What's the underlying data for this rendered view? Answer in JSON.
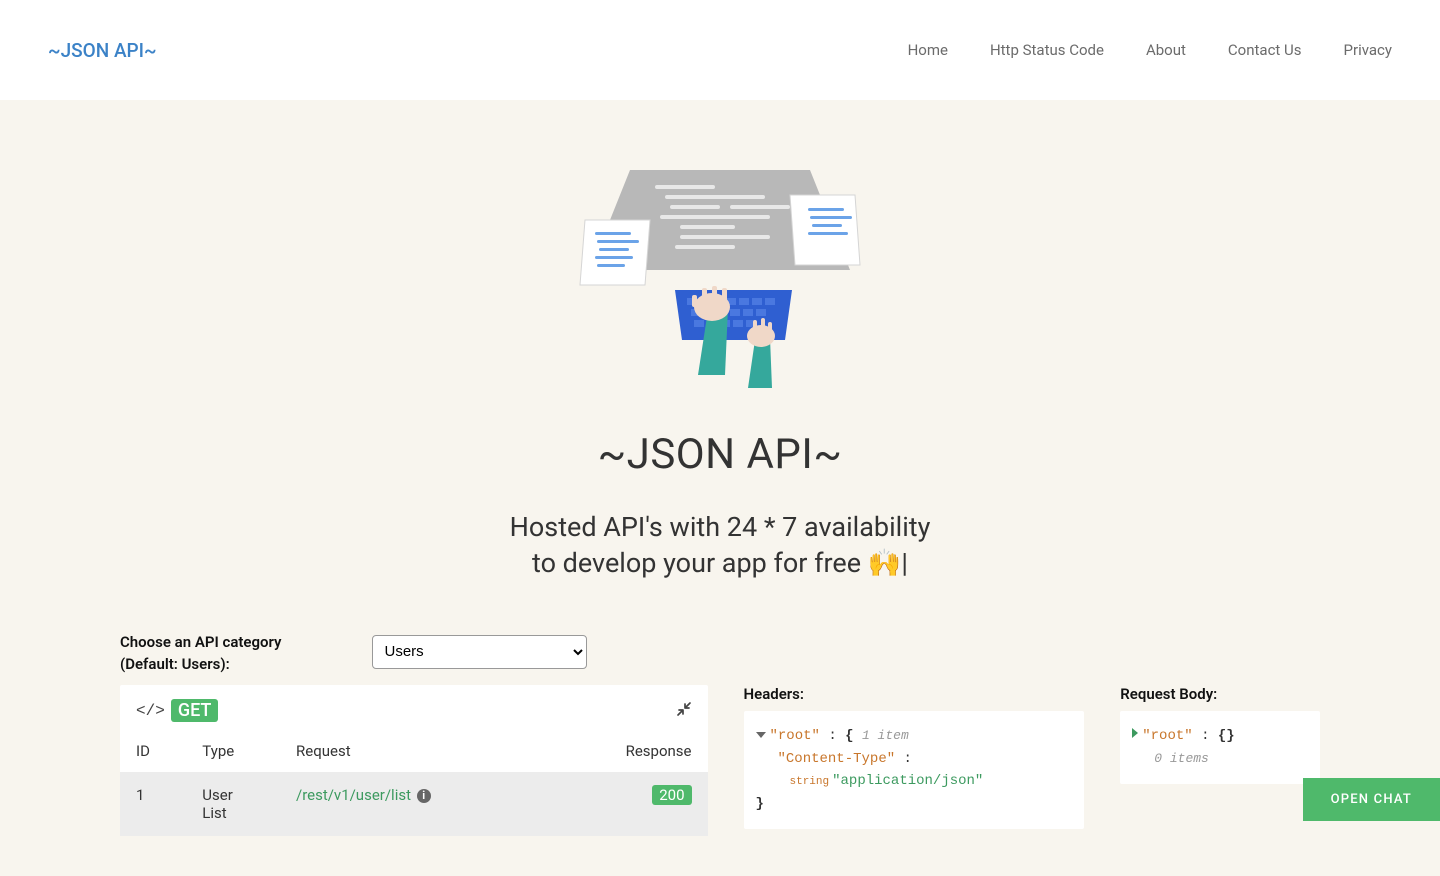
{
  "header": {
    "logo": "~JSON API~",
    "nav": [
      "Home",
      "Http Status Code",
      "About",
      "Contact Us",
      "Privacy"
    ]
  },
  "hero": {
    "title": "~JSON API~",
    "subtitle_line1": "Hosted API's with 24 * 7 availability",
    "subtitle_line2": "to develop your app for free 🙌"
  },
  "category": {
    "label_line1": "Choose an API category",
    "label_line2": "(Default: Users):",
    "selected": "Users"
  },
  "request_panel": {
    "method": "GET",
    "columns": {
      "id": "ID",
      "type": "Type",
      "request": "Request",
      "response": "Response"
    },
    "rows": [
      {
        "id": "1",
        "type_line1": "User",
        "type_line2": "List",
        "request": "/rest/v1/user/list",
        "response": "200"
      }
    ]
  },
  "headers_panel": {
    "label": "Headers:",
    "root": "\"root\"",
    "root_meta": "1 item",
    "content_type_key": "\"Content-Type\"",
    "content_type_typehint": "string",
    "content_type_value": "\"application/json\""
  },
  "body_panel": {
    "label": "Request Body:",
    "root": "\"root\"",
    "root_meta": "0 items"
  },
  "chat": {
    "label": "OPEN CHAT"
  }
}
